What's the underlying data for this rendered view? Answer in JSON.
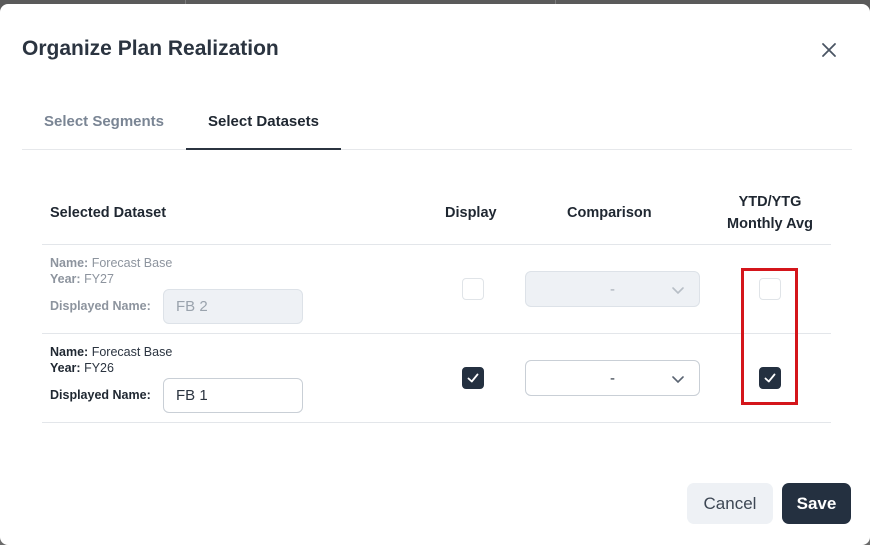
{
  "dialog": {
    "title": "Organize Plan Realization",
    "close_icon": "close-icon"
  },
  "tabs": [
    {
      "label": "Select Segments",
      "active": false
    },
    {
      "label": "Select Datasets",
      "active": true
    }
  ],
  "table": {
    "headers": {
      "selected_dataset": "Selected Dataset",
      "display": "Display",
      "comparison": "Comparison",
      "ytd_line1": "YTD/YTG",
      "ytd_line2": "Monthly Avg"
    },
    "rows": [
      {
        "name_label": "Name:",
        "name_value": "Forecast Base",
        "year_label": "Year:",
        "year_value": "FY27",
        "displayed_name_label": "Displayed Name:",
        "displayed_name_value": "FB 2",
        "display_checked": false,
        "comparison_value": "-",
        "ytd_checked": false,
        "disabled": true
      },
      {
        "name_label": "Name:",
        "name_value": "Forecast Base",
        "year_label": "Year:",
        "year_value": "FY26",
        "displayed_name_label": "Displayed Name:",
        "displayed_name_value": "FB 1",
        "display_checked": true,
        "comparison_value": "-",
        "ytd_checked": true,
        "disabled": false
      }
    ]
  },
  "footer": {
    "cancel_label": "Cancel",
    "save_label": "Save"
  },
  "colors": {
    "primary": "#243040",
    "highlight": "#d4151b",
    "muted": "#8d949e"
  }
}
